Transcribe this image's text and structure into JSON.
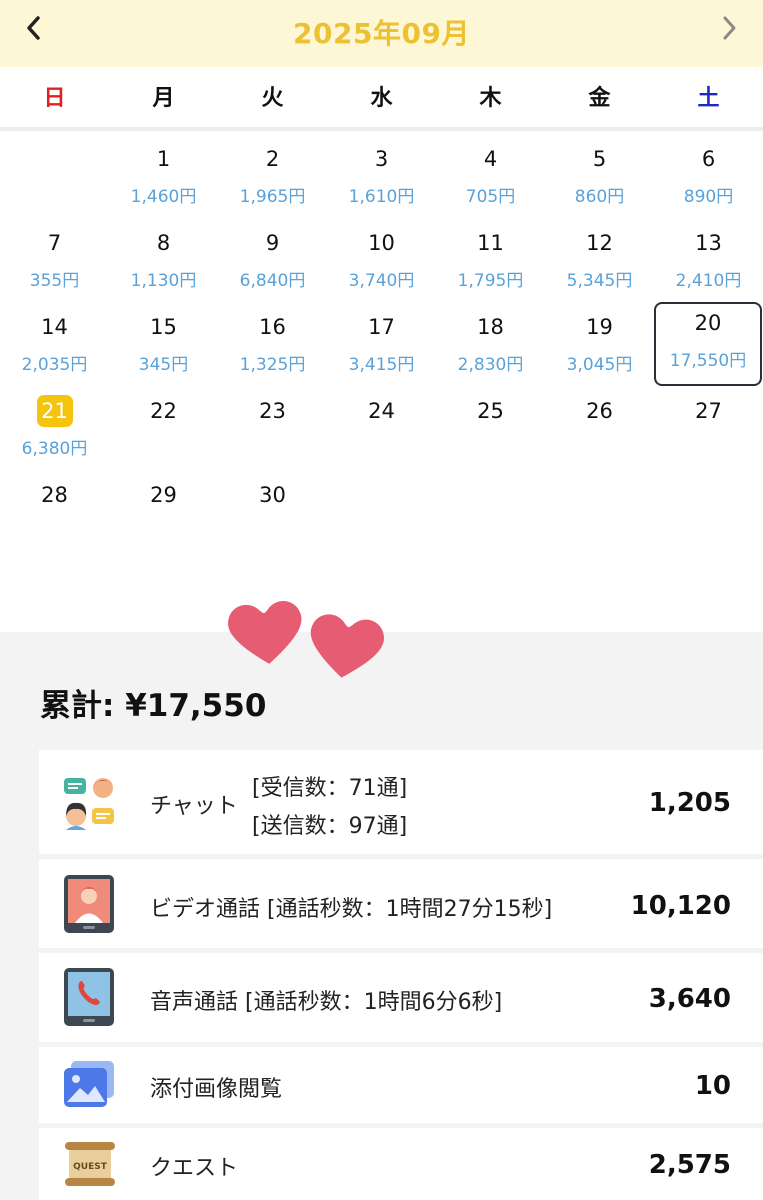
{
  "header": {
    "month_title": "2025年09月",
    "prev_icon": "chevron-left-icon",
    "next_icon": "chevron-right-icon"
  },
  "weekdays": [
    "日",
    "月",
    "火",
    "水",
    "木",
    "金",
    "土"
  ],
  "days": [
    {
      "day": "1",
      "amount": "1,460円"
    },
    {
      "day": "2",
      "amount": "1,965円"
    },
    {
      "day": "3",
      "amount": "1,610円"
    },
    {
      "day": "4",
      "amount": "705円"
    },
    {
      "day": "5",
      "amount": "860円"
    },
    {
      "day": "6",
      "amount": "890円"
    },
    {
      "day": "7",
      "amount": "355円"
    },
    {
      "day": "8",
      "amount": "1,130円"
    },
    {
      "day": "9",
      "amount": "6,840円"
    },
    {
      "day": "10",
      "amount": "3,740円"
    },
    {
      "day": "11",
      "amount": "1,795円"
    },
    {
      "day": "12",
      "amount": "5,345円"
    },
    {
      "day": "13",
      "amount": "2,410円"
    },
    {
      "day": "14",
      "amount": "2,035円"
    },
    {
      "day": "15",
      "amount": "345円"
    },
    {
      "day": "16",
      "amount": "1,325円"
    },
    {
      "day": "17",
      "amount": "3,415円"
    },
    {
      "day": "18",
      "amount": "2,830円"
    },
    {
      "day": "19",
      "amount": "3,045円"
    },
    {
      "day": "20",
      "amount": "17,550円",
      "selected": true
    },
    {
      "day": "21",
      "amount": "6,380円",
      "today": true
    },
    {
      "day": "22",
      "amount": ""
    },
    {
      "day": "23",
      "amount": ""
    },
    {
      "day": "24",
      "amount": ""
    },
    {
      "day": "25",
      "amount": ""
    },
    {
      "day": "26",
      "amount": ""
    },
    {
      "day": "27",
      "amount": ""
    },
    {
      "day": "28",
      "amount": ""
    },
    {
      "day": "29",
      "amount": ""
    },
    {
      "day": "30",
      "amount": ""
    }
  ],
  "summary": {
    "total_label": "累計: ¥17,550",
    "items": [
      {
        "icon": "chat-people-icon",
        "label": "チャット",
        "detail1": "[受信数：71通]",
        "detail2": "[送信数：97通]",
        "value": "1,205"
      },
      {
        "icon": "video-call-tablet-icon",
        "label": "ビデオ通話 [通話秒数：1時間27分15秒]",
        "value": "10,120"
      },
      {
        "icon": "voice-call-tablet-icon",
        "label": "音声通話 [通話秒数：1時間6分6秒]",
        "value": "3,640"
      },
      {
        "icon": "image-attachment-icon",
        "label": "添付画像閲覧",
        "value": "10"
      },
      {
        "icon": "quest-scroll-icon",
        "label": "クエスト",
        "value": "2,575"
      }
    ]
  },
  "colors": {
    "header_bg": "#fdf7d6",
    "month_title": "#ecc232",
    "amount": "#5aa2d8",
    "today_badge": "#f4c40f",
    "sunday": "#e02020",
    "saturday": "#1c2bbd",
    "heart": "#e65c72"
  }
}
